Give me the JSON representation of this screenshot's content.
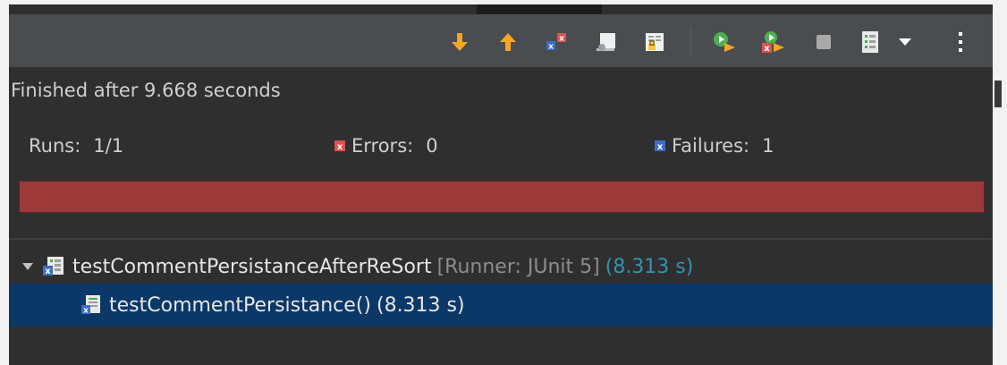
{
  "toolbar": {
    "buttons": [
      {
        "name": "next-failure-button",
        "icon": "arrow-down-icon",
        "color": "#f5a623"
      },
      {
        "name": "previous-failure-button",
        "icon": "arrow-up-icon",
        "color": "#f5a623"
      },
      {
        "name": "show-failures-only-button",
        "icon": "failures-filter-icon"
      },
      {
        "name": "show-skipped-only-button",
        "icon": "skipped-filter-icon"
      },
      {
        "name": "scroll-lock-button",
        "icon": "scroll-lock-icon"
      },
      {
        "name": "rerun-test-button",
        "icon": "rerun-icon",
        "color": "#4caf50"
      },
      {
        "name": "rerun-failed-first-button",
        "icon": "rerun-failed-icon"
      },
      {
        "name": "stop-button",
        "icon": "stop-icon"
      },
      {
        "name": "test-run-history-button",
        "icon": "history-icon"
      },
      {
        "name": "history-dropdown-button",
        "icon": "chevron-down-icon"
      },
      {
        "name": "view-menu-button",
        "icon": "kebab-menu-icon"
      }
    ]
  },
  "status": {
    "message": "Finished after 9.668 seconds"
  },
  "counters": {
    "runs_label": "Runs:",
    "runs_value": "1/1",
    "errors_label": "Errors:",
    "errors_value": "0",
    "failures_label": "Failures:",
    "failures_value": "1"
  },
  "progress": {
    "fraction": 1.0,
    "color": "#9c3a3a"
  },
  "tree": {
    "suite": {
      "name": "testCommentPersistanceAfterReSort",
      "runner": "[Runner: JUnit 5]",
      "time": "(8.313 s)"
    },
    "test": {
      "name": "testCommentPersistance()",
      "time": "(8.313 s)"
    }
  },
  "colors": {
    "toolbar_bg": "#4a4d50",
    "panel_bg": "#2f2f2f",
    "selection_bg": "#0c3868",
    "time_accent": "#2f95b3",
    "error_red": "#d9534f",
    "failure_blue": "#3b6cc9"
  }
}
